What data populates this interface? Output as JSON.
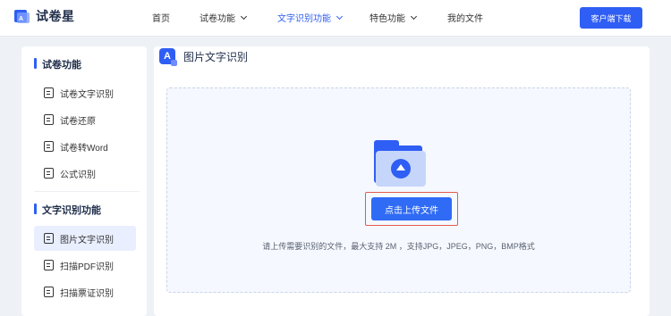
{
  "header": {
    "brand": "试卷星",
    "nav": [
      {
        "label": "首页",
        "active": false,
        "dropdown": false
      },
      {
        "label": "试卷功能",
        "active": false,
        "dropdown": true
      },
      {
        "label": "文字识别功能",
        "active": true,
        "dropdown": true
      },
      {
        "label": "特色功能",
        "active": false,
        "dropdown": true
      },
      {
        "label": "我的文件",
        "active": false,
        "dropdown": false
      }
    ],
    "download_label": "客户端下载"
  },
  "sidebar": {
    "sections": [
      {
        "title": "试卷功能",
        "items": [
          {
            "label": "试卷文字识别",
            "icon": "document-scan-icon"
          },
          {
            "label": "试卷还原",
            "icon": "document-restore-icon"
          },
          {
            "label": "试卷转Word",
            "icon": "document-word-icon"
          },
          {
            "label": "公式识别",
            "icon": "formula-icon"
          }
        ]
      },
      {
        "title": "文字识别功能",
        "items": [
          {
            "label": "图片文字识别",
            "icon": "image-text-icon",
            "active": true
          },
          {
            "label": "扫描PDF识别",
            "icon": "pdf-scan-icon"
          },
          {
            "label": "扫描票证识别",
            "icon": "ticket-scan-icon"
          }
        ]
      }
    ]
  },
  "main": {
    "title": "图片文字识别",
    "upload_button": "点击上传文件",
    "hint": "请上传需要识别的文件，最大支持 2M ，支持JPG，JPEG，PNG，BMP格式"
  },
  "colors": {
    "accent": "#2f5ef4",
    "highlight_border": "#e35b4b",
    "page_bg": "#eef1f6"
  }
}
